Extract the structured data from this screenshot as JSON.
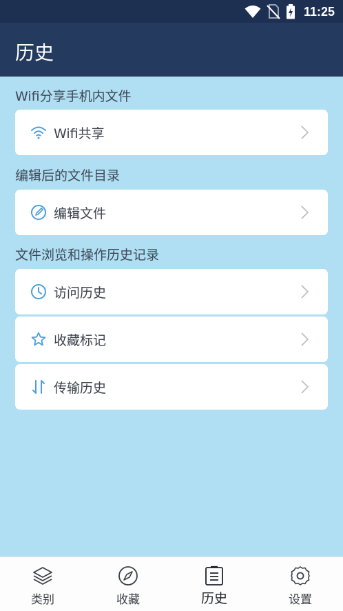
{
  "status_bar": {
    "time": "11:25",
    "icons": [
      "wifi-icon",
      "no-sim-icon",
      "battery-charging-icon"
    ]
  },
  "app_bar": {
    "title": "历史"
  },
  "sections": [
    {
      "title": "Wifi分享手机内文件",
      "items": [
        {
          "label": "Wifi共享",
          "icon": "wifi-icon"
        }
      ]
    },
    {
      "title": "编辑后的文件目录",
      "items": [
        {
          "label": "编辑文件",
          "icon": "edit-icon"
        }
      ]
    },
    {
      "title": "文件浏览和操作历史记录",
      "items": [
        {
          "label": "访问历史",
          "icon": "clock-icon"
        },
        {
          "label": "收藏标记",
          "icon": "star-icon"
        },
        {
          "label": "传输历史",
          "icon": "transfer-icon"
        }
      ]
    }
  ],
  "bottom_nav": {
    "tabs": [
      {
        "label": "类别",
        "icon": "layers-icon"
      },
      {
        "label": "收藏",
        "icon": "compass-icon"
      },
      {
        "label": "历史",
        "icon": "clipboard-icon",
        "active": true
      },
      {
        "label": "设置",
        "icon": "gear-icon"
      }
    ]
  },
  "colors": {
    "accent": "#4a9fd8",
    "app_bar": "#243a5e",
    "status_bar": "#1e3052",
    "background": "#b0def2"
  }
}
